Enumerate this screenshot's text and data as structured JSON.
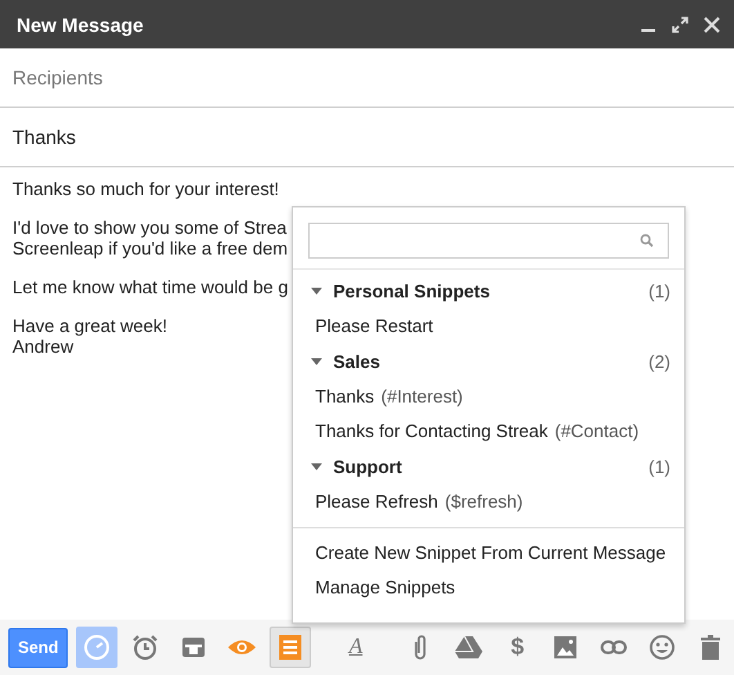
{
  "window": {
    "title": "New Message"
  },
  "recipients": {
    "placeholder": "Recipients"
  },
  "subject": {
    "value": "Thanks"
  },
  "body": {
    "paragraphs": [
      [
        "Thanks so much for your interest!"
      ],
      [
        "I'd love to show you some of Strea",
        "Screenleap if you'd like a free dem"
      ],
      [
        "Let me know what time would be g"
      ],
      [
        "Have a great week!",
        "Andrew"
      ]
    ]
  },
  "snippets_menu": {
    "groups": [
      {
        "title": "Personal Snippets",
        "count": "(1)",
        "expanded": true,
        "items": [
          {
            "name": "Please Restart"
          }
        ]
      },
      {
        "title": "Sales",
        "count": "(2)",
        "expanded": true,
        "items": [
          {
            "name": "Thanks",
            "shortcut": "(#Interest)"
          },
          {
            "name": "Thanks for Contacting Streak",
            "shortcut": "(#Contact)"
          }
        ]
      },
      {
        "title": "Support",
        "count": "(1)",
        "expanded": true,
        "items": [
          {
            "name": "Please Refresh",
            "shortcut": "($refresh)"
          }
        ]
      }
    ],
    "actions": [
      "Create New Snippet From Current Message",
      "Manage Snippets"
    ]
  },
  "toolbar": {
    "send": "Send",
    "tools": [
      {
        "kind": "schedule",
        "active": true
      },
      {
        "kind": "reminder",
        "active": false
      },
      {
        "kind": "template",
        "active": false
      },
      {
        "kind": "tracking",
        "active": false
      },
      {
        "kind": "snippets",
        "active": true
      },
      {
        "kind": "format",
        "label": "A",
        "active": false
      },
      {
        "kind": "attach",
        "active": false
      },
      {
        "kind": "drive",
        "active": false
      },
      {
        "kind": "money",
        "label": "$",
        "active": false
      },
      {
        "kind": "photo",
        "active": false
      },
      {
        "kind": "link",
        "active": false
      },
      {
        "kind": "emoji",
        "active": false
      },
      {
        "kind": "trash",
        "active": false
      }
    ]
  }
}
